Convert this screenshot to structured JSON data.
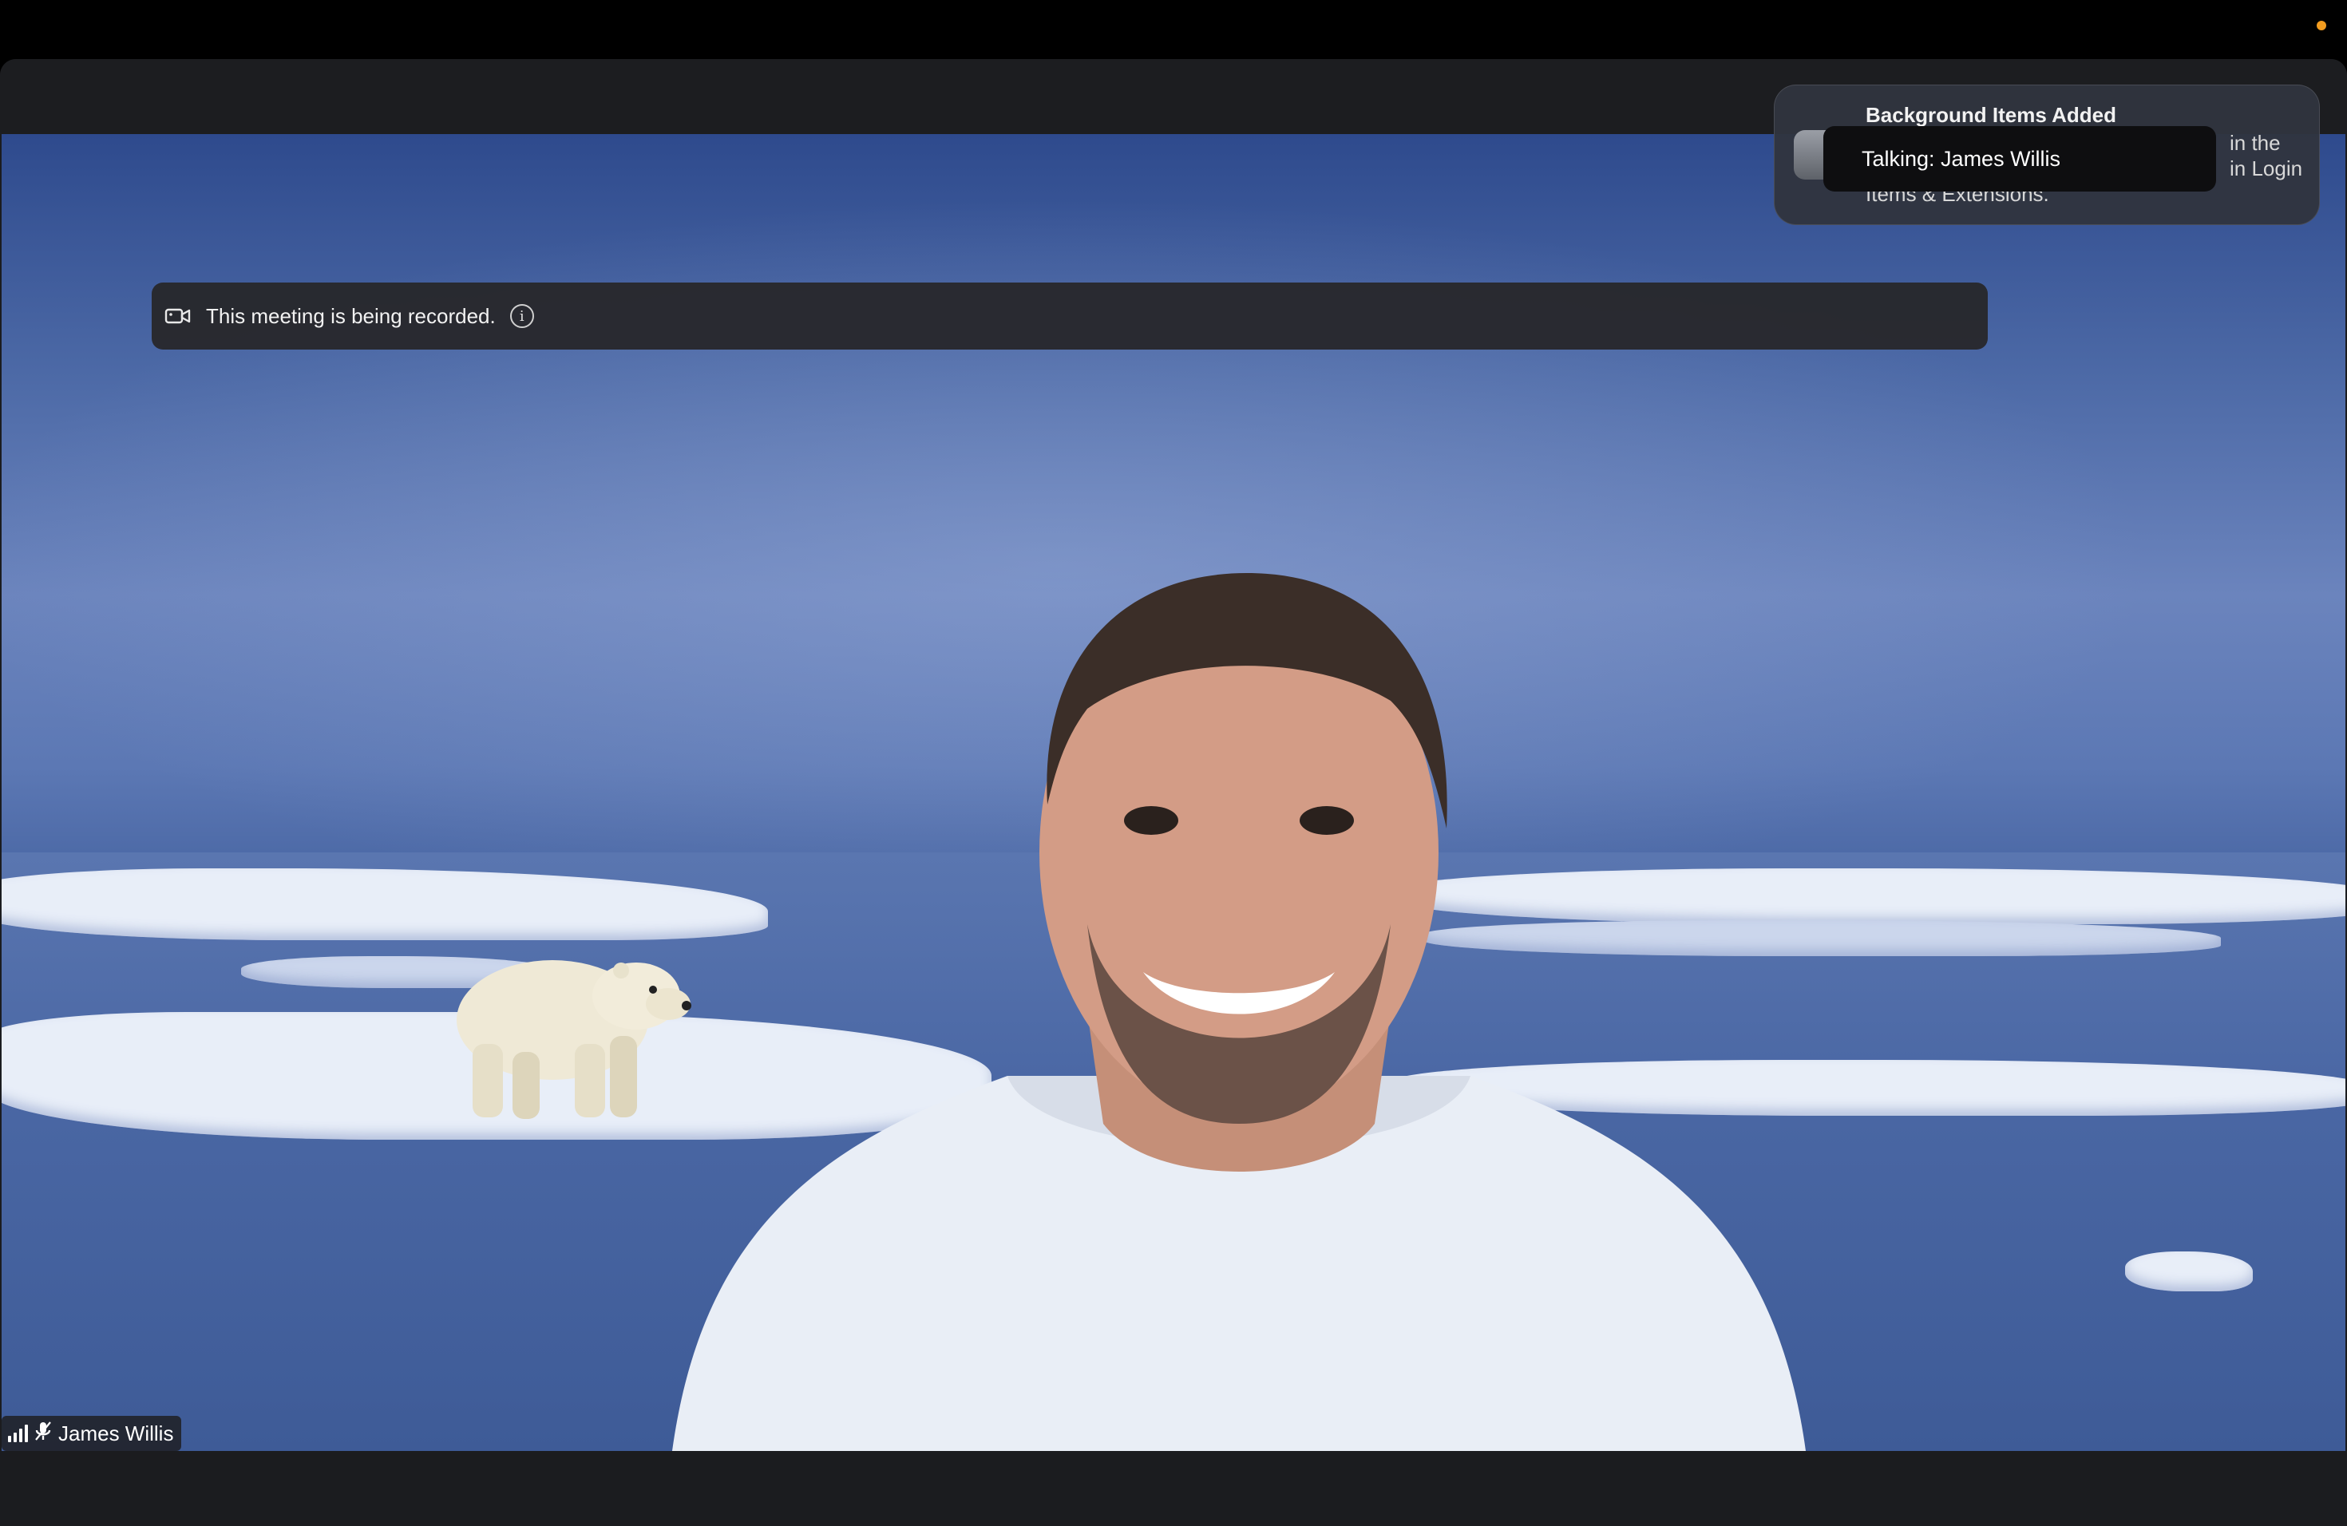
{
  "recording_banner": {
    "text": "This meeting is being recorded.",
    "camera_icon": "video-camera-icon",
    "info_icon": "info-icon"
  },
  "notification": {
    "title": "Background Items Added",
    "body_right_line1": "in the",
    "body_right_line2": "in Login",
    "body_bottom": "Items & Extensions.",
    "icon": "system-settings-icon"
  },
  "talking_indicator": {
    "text": "Talking: James Willis"
  },
  "participant": {
    "name": "James Willis",
    "signal_icon": "signal-strength-icon",
    "mic_icon": "microphone-icon"
  },
  "colors": {
    "menubar": "#000000",
    "camera_in_use_dot": "#f29c1f",
    "window_chrome": "#1b1c1f"
  }
}
